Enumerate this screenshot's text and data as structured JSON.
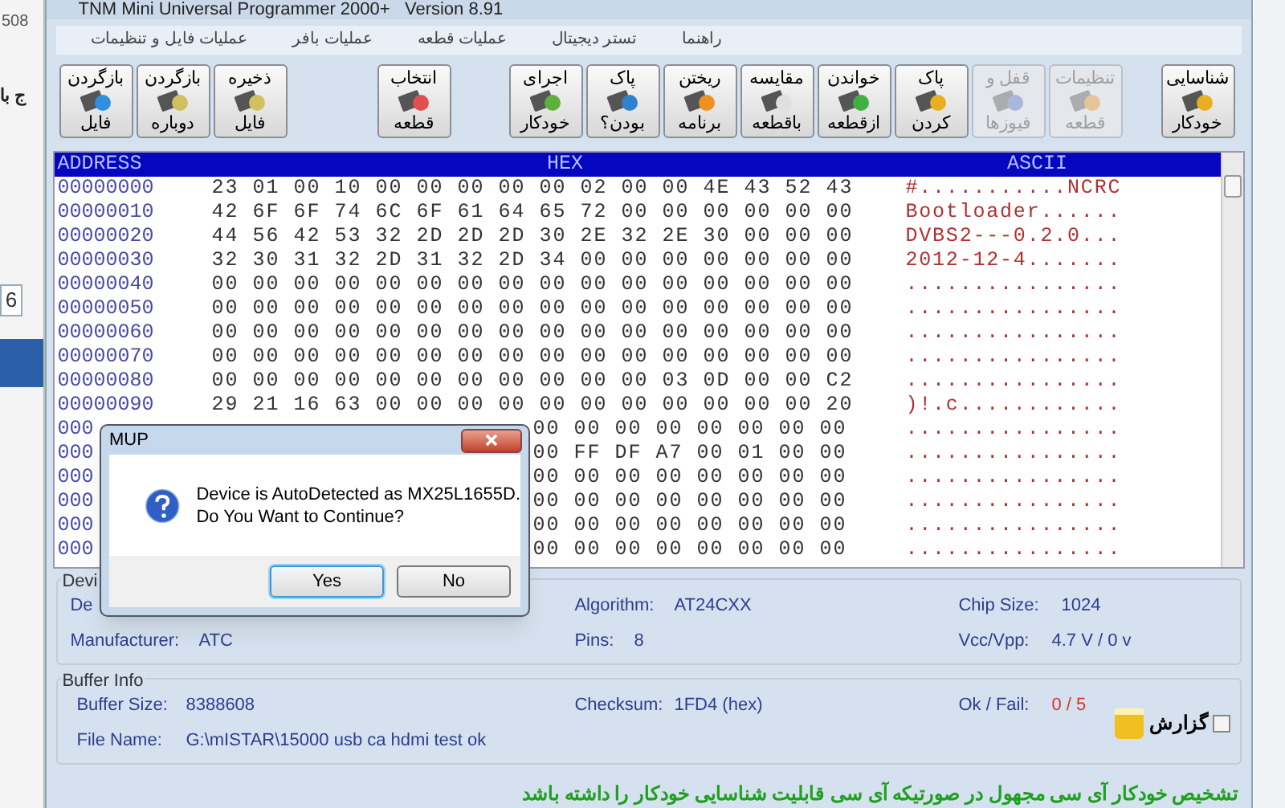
{
  "background": {
    "corner_text": "508",
    "side_text": "ج با",
    "side_box": "6"
  },
  "window": {
    "title": "TNM Mini Universal Programmer 2000+   Version 8.91"
  },
  "menu": [
    "راهنما",
    "تستر دیجیتال",
    "عملیات قطعه",
    "عملیات بافر",
    "عملیات فایل و تنظیمات"
  ],
  "toolbar": [
    {
      "lines": [
        "شناسایی",
        "خودکار"
      ],
      "disabled": false
    },
    {
      "lines": [
        "تنظیمات",
        "قطعه"
      ],
      "disabled": true
    },
    {
      "lines": [
        "قفل و",
        "فیوزها"
      ],
      "disabled": true
    },
    {
      "lines": [
        "پاک",
        "کردن"
      ],
      "disabled": false
    },
    {
      "lines": [
        "خواندن",
        "ازقطعه"
      ],
      "disabled": false
    },
    {
      "lines": [
        "مقایسه",
        "باقطعه"
      ],
      "disabled": false
    },
    {
      "lines": [
        "ریختن",
        "برنامه"
      ],
      "disabled": false
    },
    {
      "lines": [
        "پاک",
        "بودن؟"
      ],
      "disabled": false
    },
    {
      "lines": [
        "اجرای",
        "خودکار"
      ],
      "disabled": false
    },
    {
      "lines": [
        "انتخاب",
        "قطعه"
      ],
      "disabled": false
    },
    {
      "lines": [
        "ذخیره",
        "فایل"
      ],
      "disabled": false
    },
    {
      "lines": [
        "بازگردن",
        "دوباره"
      ],
      "disabled": false
    },
    {
      "lines": [
        "بازگردن",
        "فایل"
      ],
      "disabled": false
    }
  ],
  "hex_view": {
    "address_header": "ADDRESS",
    "hex_header": "HEX",
    "ascii_header": "ASCII",
    "rows": [
      {
        "address": "00000000",
        "hex": "23 01 00 10 00 00 00 00 00 02 00 00 4E 43 52 43",
        "ascii": "#...........NCRC"
      },
      {
        "address": "00000010",
        "hex": "42 6F 6F 74 6C 6F 61 64 65 72 00 00 00 00 00 00",
        "ascii": "Bootloader......"
      },
      {
        "address": "00000020",
        "hex": "44 56 42 53 32 2D 2D 2D 30 2E 32 2E 30 00 00 00",
        "ascii": "DVBS2---0.2.0..."
      },
      {
        "address": "00000030",
        "hex": "32 30 31 32 2D 31 32 2D 34 00 00 00 00 00 00 00",
        "ascii": "2012-12-4......."
      },
      {
        "address": "00000040",
        "hex": "00 00 00 00 00 00 00 00 00 00 00 00 00 00 00 00",
        "ascii": "................"
      },
      {
        "address": "00000050",
        "hex": "00 00 00 00 00 00 00 00 00 00 00 00 00 00 00 00",
        "ascii": "................"
      },
      {
        "address": "00000060",
        "hex": "00 00 00 00 00 00 00 00 00 00 00 00 00 00 00 00",
        "ascii": "................"
      },
      {
        "address": "00000070",
        "hex": "00 00 00 00 00 00 00 00 00 00 00 00 00 00 00 00",
        "ascii": "................"
      },
      {
        "address": "00000080",
        "hex": "00 00 00 00 00 00 00 00 00 00 00 03 0D 00 00 C2",
        "ascii": "................"
      },
      {
        "address": "00000090",
        "hex": "29 21 16 63 00 00 00 00 00 00 00 00 00 00 00 20",
        "ascii": ")!.c............"
      },
      {
        "address": "000",
        "hex_tail": "00 00 00 00 00 00 00 00",
        "ascii": "................"
      },
      {
        "address": "000",
        "hex_tail": "00 FF DF A7 00 01 00 00",
        "ascii": "................"
      },
      {
        "address": "000",
        "hex_tail": "00 00 00 00 00 00 00 00",
        "ascii": "................"
      },
      {
        "address": "000",
        "hex_tail": "00 00 00 00 00 00 00 00",
        "ascii": "................"
      },
      {
        "address": "000",
        "hex_tail": "00 00 00 00 00 00 00 00",
        "ascii": "................"
      },
      {
        "address": "000",
        "hex_tail": "00 00 00 00 00 00 00 00",
        "ascii": "................"
      }
    ]
  },
  "device_info": {
    "title": "Devi",
    "label_1": "De",
    "algorithm_label": "Algorithm:",
    "algorithm": "AT24CXX",
    "chip_size_label": "Chip Size:",
    "chip_size": "1024",
    "manufacturer_label": "Manufacturer:",
    "manufacturer": "ATC",
    "pins_label": "Pins:",
    "pins": "8",
    "vcc_label": "Vcc/Vpp:",
    "vcc": "4.7 V / 0 v"
  },
  "buffer_info": {
    "title": "Buffer Info",
    "size_label": "Buffer Size:",
    "size": "8388608",
    "checksum_label": "Checksum:",
    "checksum": "1FD4 (hex)",
    "okfail_label": "Ok / Fail:",
    "okfail": "0 / 5",
    "file_label": "File Name:",
    "file": "G:\\mISTAR\\15000 usb ca hdmi test ok",
    "report_label": "گزارش",
    "report_checked": false
  },
  "hint": "تشخیص خودکار آی سی مجهول در صورتیکه آی سی قابلیت شناسایی خودکار را داشته باشد",
  "dialog": {
    "title": "MUP",
    "message_lines": [
      "Device is AutoDetected as MX25L1655D.",
      "Do You Want to Continue?"
    ],
    "yes_button": {
      "label": "Yes",
      "selected": true
    },
    "no_button": {
      "label": "No",
      "selected": false
    }
  }
}
